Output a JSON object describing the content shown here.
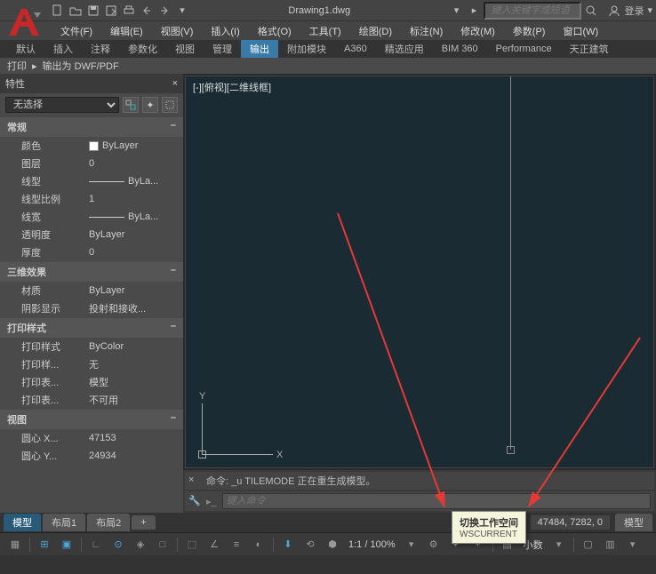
{
  "title": "Drawing1.dwg",
  "search_placeholder": "键入关键字或短语",
  "login_label": "登录",
  "menu": [
    "文件(F)",
    "编辑(E)",
    "视图(V)",
    "插入(I)",
    "格式(O)",
    "工具(T)",
    "绘图(D)",
    "标注(N)",
    "修改(M)",
    "参数(P)",
    "窗口(W)"
  ],
  "ribbon_tabs": [
    "默认",
    "插入",
    "注释",
    "参数化",
    "视图",
    "管理",
    "输出",
    "附加模块",
    "A360",
    "精选应用",
    "BIM 360",
    "Performance",
    "天正建筑"
  ],
  "ribbon_tabs_active": 6,
  "ribbon_panel": {
    "a": "打印",
    "b": "输出为 DWF/PDF"
  },
  "props": {
    "title": "特性",
    "select_value": "无选择",
    "cats": {
      "general": "常规",
      "threed": "三维效果",
      "plot": "打印样式",
      "view": "视图"
    },
    "rows": {
      "color": {
        "l": "颜色",
        "v": "ByLayer"
      },
      "layer": {
        "l": "图层",
        "v": "0"
      },
      "ltype": {
        "l": "线型",
        "v": "ByLa..."
      },
      "lscale": {
        "l": "线型比例",
        "v": "1"
      },
      "lweight": {
        "l": "线宽",
        "v": "ByLa..."
      },
      "transp": {
        "l": "透明度",
        "v": "ByLayer"
      },
      "thick": {
        "l": "厚度",
        "v": "0"
      },
      "material": {
        "l": "材质",
        "v": "ByLayer"
      },
      "shadow": {
        "l": "阴影显示",
        "v": "投射和接收..."
      },
      "pstyle": {
        "l": "打印样式",
        "v": "ByColor"
      },
      "pstyle2": {
        "l": "打印样...",
        "v": "无"
      },
      "ptable": {
        "l": "打印表...",
        "v": "模型"
      },
      "ptable2": {
        "l": "打印表...",
        "v": "不可用"
      },
      "cx": {
        "l": "圆心 X...",
        "v": "47153"
      },
      "cy": {
        "l": "圆心 Y...",
        "v": "24934"
      }
    }
  },
  "viewport_label": "[-][俯视][二维线框]",
  "ucs": {
    "x": "X",
    "y": "Y"
  },
  "cmd_history": "命令: _u TILEMODE 正在重生成模型。",
  "cmd_placeholder": "键入命令",
  "doc_tabs": [
    "模型",
    "布局1",
    "布局2"
  ],
  "doc_tabs_active": 0,
  "coords": "47484, 7282, 0",
  "coords_suffix": "模型",
  "status_scale": "1:1 / 100%",
  "status_units": "小数",
  "tooltip": {
    "title": "切换工作空间",
    "cmd": "WSCURRENT"
  }
}
